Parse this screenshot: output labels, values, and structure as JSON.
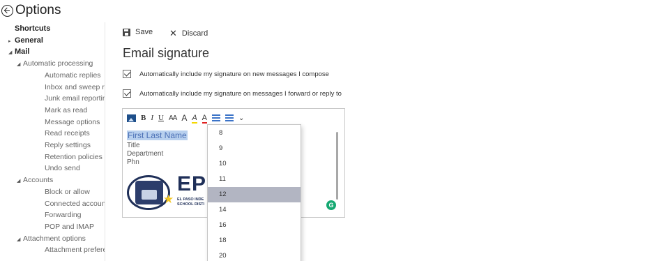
{
  "header": {
    "title": "Options"
  },
  "sidebar": {
    "items": [
      {
        "label": "Shortcuts",
        "level": 0,
        "bold": true,
        "arrow": ""
      },
      {
        "label": "General",
        "level": 0,
        "bold": true,
        "arrow": "▸"
      },
      {
        "label": "Mail",
        "level": 0,
        "bold": true,
        "arrow": "◢"
      },
      {
        "label": "Automatic processing",
        "level": 1,
        "arrow": "◢"
      },
      {
        "label": "Automatic replies",
        "level": 2
      },
      {
        "label": "Inbox and sweep rules",
        "level": 2
      },
      {
        "label": "Junk email reporting",
        "level": 2
      },
      {
        "label": "Mark as read",
        "level": 2
      },
      {
        "label": "Message options",
        "level": 2
      },
      {
        "label": "Read receipts",
        "level": 2
      },
      {
        "label": "Reply settings",
        "level": 2
      },
      {
        "label": "Retention policies",
        "level": 2
      },
      {
        "label": "Undo send",
        "level": 2
      },
      {
        "label": "Accounts",
        "level": 1,
        "arrow": "◢"
      },
      {
        "label": "Block or allow",
        "level": 2
      },
      {
        "label": "Connected accounts",
        "level": 2
      },
      {
        "label": "Forwarding",
        "level": 2
      },
      {
        "label": "POP and IMAP",
        "level": 2
      },
      {
        "label": "Attachment options",
        "level": 1,
        "arrow": "◢"
      },
      {
        "label": "Attachment preferences",
        "level": 2
      }
    ]
  },
  "toolbar": {
    "save_label": "Save",
    "discard_label": "Discard"
  },
  "page": {
    "title": "Email signature"
  },
  "options": {
    "auto_new": {
      "label": "Automatically include my signature on new messages I compose",
      "checked": true
    },
    "auto_reply": {
      "label": "Automatically include my signature on messages I forward or reply to",
      "checked": true
    }
  },
  "editor": {
    "format_buttons": [
      {
        "name": "insert-image-icon",
        "glyph": ""
      },
      {
        "name": "bold-button",
        "glyph": "B"
      },
      {
        "name": "italic-button",
        "glyph": "I"
      },
      {
        "name": "underline-button",
        "glyph": "U"
      },
      {
        "name": "font-size-button",
        "glyph": "AA"
      },
      {
        "name": "grow-font-button",
        "glyph": "A"
      },
      {
        "name": "highlight-button",
        "glyph": "A"
      },
      {
        "name": "font-color-button",
        "glyph": "A"
      },
      {
        "name": "bullets-button",
        "glyph": ""
      },
      {
        "name": "numbering-button",
        "glyph": ""
      },
      {
        "name": "more-formatting-button",
        "glyph": "⌄"
      }
    ],
    "highlight_color": "#f5d800",
    "font_color": "#e02020",
    "signature": {
      "name": "First Last Name",
      "title": "Title",
      "department": "Department",
      "phone": "Phn"
    },
    "logo": {
      "word": "EPIS",
      "line1": "EL PASO INDE",
      "line2": "SCHOOL DISTI"
    },
    "grammarly_glyph": "G"
  },
  "font_size_dropdown": {
    "options": [
      "8",
      "9",
      "10",
      "11",
      "12",
      "14",
      "16",
      "18",
      "20"
    ],
    "selected": "12"
  },
  "colors": {
    "accent": "#1e4f8a",
    "selection": "#b8d0ee",
    "dropdown_selected": "#b2b5c2",
    "grammarly": "#15a872"
  }
}
